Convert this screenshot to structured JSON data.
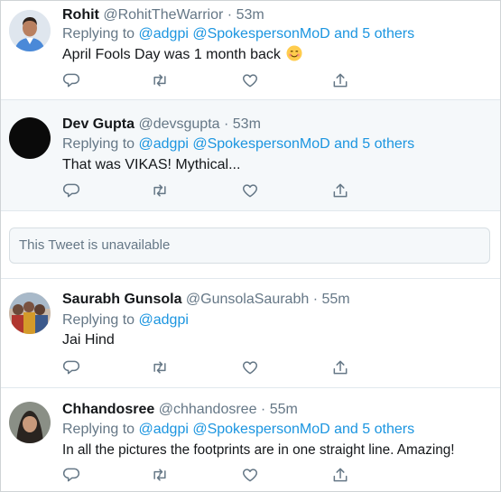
{
  "colors": {
    "link": "#1b95e0",
    "muted": "#657786",
    "text": "#14171a",
    "alt_bg": "#f5f8fa"
  },
  "replying_prefix": "Replying to",
  "tweets": [
    {
      "name": "Rohit",
      "handle": "@RohitTheWarrior",
      "sep": "·",
      "time": "53m",
      "mentions": "@adgpi @SpokespersonMoD",
      "others": "and 5 others",
      "text": "April Fools Day was 1 month back",
      "emoji": "smiling-face-emoji"
    },
    {
      "name": "Dev Gupta",
      "handle": "@devsgupta",
      "sep": "·",
      "time": "53m",
      "mentions": "@adgpi @SpokespersonMoD",
      "others": "and 5 others",
      "text": "That was VIKAS! Mythical..."
    },
    {
      "name": "Saurabh Gunsola",
      "handle": "@GunsolaSaurabh",
      "sep": "·",
      "time": "55m",
      "mentions": "@adgpi",
      "others": "",
      "text": "Jai Hind"
    },
    {
      "name": "Chhandosree",
      "handle": "@chhandosree",
      "sep": "·",
      "time": "55m",
      "mentions": "@adgpi @SpokespersonMoD",
      "others": "and 5 others",
      "text": "In all the pictures the footprints are in one straight line. Amazing!"
    }
  ],
  "unavailable_text": "This Tweet is unavailable",
  "action_icons": [
    "reply-icon",
    "retweet-icon",
    "like-icon",
    "share-icon"
  ]
}
